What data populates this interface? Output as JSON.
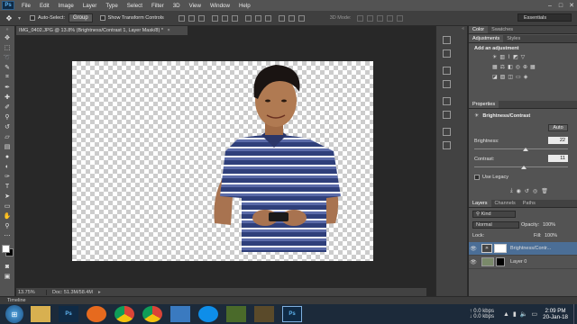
{
  "app": {
    "logo": "Ps"
  },
  "menubar": {
    "items": [
      "File",
      "Edit",
      "Image",
      "Layer",
      "Type",
      "Select",
      "Filter",
      "3D",
      "View",
      "Window",
      "Help"
    ]
  },
  "options_bar": {
    "auto_select_label": "Auto-Select:",
    "auto_select_value": "Group",
    "transform_label": "Show Transform Controls",
    "mode_3d_label": "3D Mode:",
    "workspace": "Essentials"
  },
  "document": {
    "tab_title": "IMG_0402.JPG @ 13.8% (Brightness/Contrast 1, Layer Mask/8) *",
    "zoom": "13.75%",
    "doc_size": "Doc: 51.3M/58.4M"
  },
  "timeline": {
    "label": "Timeline"
  },
  "color_panel": {
    "tabs": [
      "Color",
      "Swatches"
    ]
  },
  "adjustments_panel": {
    "tabs": [
      "Adjustments",
      "Styles"
    ],
    "heading": "Add an adjustment"
  },
  "properties_panel": {
    "tab": "Properties",
    "title": "Brightness/Contrast",
    "auto_button": "Auto",
    "brightness_label": "Brightness:",
    "brightness_value": "22",
    "contrast_label": "Contrast:",
    "contrast_value": "11",
    "legacy_label": "Use Legacy",
    "brightness_fraction": 0.55,
    "contrast_fraction": 0.53
  },
  "layers_panel": {
    "tabs": [
      "Layers",
      "Channels",
      "Paths"
    ],
    "kind_filter": "Kind",
    "blend_mode": "Normal",
    "opacity_label": "Opacity:",
    "opacity_value": "100%",
    "lock_label": "Lock:",
    "fill_label": "Fill:",
    "fill_value": "100%",
    "layers": [
      {
        "name": "Brightness/Contr...",
        "selected": true
      },
      {
        "name": "Layer 0",
        "selected": false
      }
    ]
  },
  "taskbar": {
    "apps": [
      "file-explorer",
      "photoshop",
      "firefox",
      "chrome",
      "chrome-alt",
      "image-viewer",
      "teamviewer",
      "game",
      "game-alt",
      "photoshop-active"
    ],
    "net_up": "0.0 kbps",
    "net_down": "0.0 kbps",
    "time": "2:09 PM",
    "date": "20-Jan-18"
  },
  "colors": {
    "accent": "#4b6e96",
    "chrome_bg": "#535353",
    "canvas_bg": "#282828",
    "shirt_navy": "#2f3f7a"
  }
}
